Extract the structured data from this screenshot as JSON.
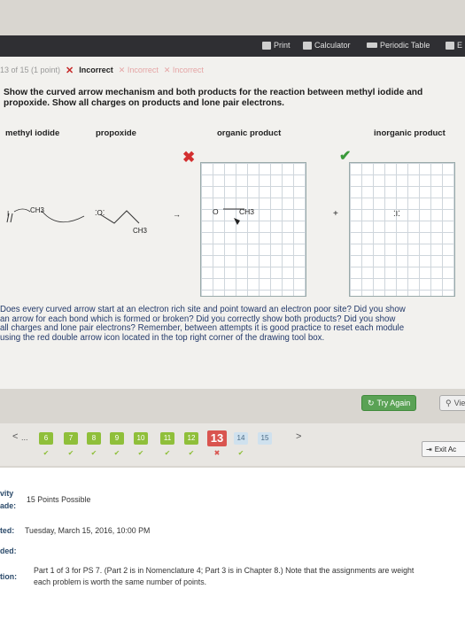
{
  "toolbar": {
    "print": "Print",
    "calculator": "Calculator",
    "periodic_table": "Periodic Table",
    "extra": "E"
  },
  "status": {
    "points": "13 of 15 (1 point)",
    "incorrect": "Incorrect",
    "attempt2": "Incorrect",
    "attempt3": "Incorrect"
  },
  "question": "Show the curved arrow mechanism and both products for the reaction between methyl iodide and propoxide. Show all charges on products and lone pair electrons.",
  "columns": {
    "methyl_iodide": "methyl iodide",
    "propoxide": "propoxide",
    "organic_product": "organic product",
    "inorganic_product": "inorganic product"
  },
  "chem": {
    "ch3_a": "CH3",
    "ch3_b": "CH3",
    "ch3_c": "CH3",
    "iodine": "I",
    "oxygen": "O",
    "oxygen2": "O",
    "iodide": "I",
    "plus": "+",
    "arrow": "→"
  },
  "feedback": [
    "Does every curved arrow start at an electron rich site and point toward an electron poor site? Did you show",
    "an arrow for each bond which is formed or broken? Did you correctly show both products? Did you show",
    "all charges and lone pair electrons? Remember, between attempts it is good practice to reset each module",
    "using the red double arrow icon located in the top right corner of the drawing tool box."
  ],
  "buttons": {
    "try_again": "Try Again",
    "view": "View",
    "exit": "Exit Ac"
  },
  "pager": {
    "prev": "<",
    "ellipsis": "...",
    "next": ">",
    "pages": [
      "6",
      "7",
      "8",
      "9",
      "10",
      "11",
      "12",
      "13",
      "14",
      "15"
    ]
  },
  "info": {
    "activity_label": "vity",
    "points_label": "15 Points Possible",
    "grade_label": "ade:",
    "due_label": "ted:",
    "due_value": "Tuesday, March 15, 2016, 10:00 PM",
    "graded_label": "ded:",
    "instr_label": "tion:",
    "instr_line1": "Part 1 of 3 for PS 7. (Part 2 is in Nomenclature 4; Part 3 is in Chapter 8.) Note that the assignments are weight",
    "instr_line2": "each problem is worth the same number of points."
  }
}
